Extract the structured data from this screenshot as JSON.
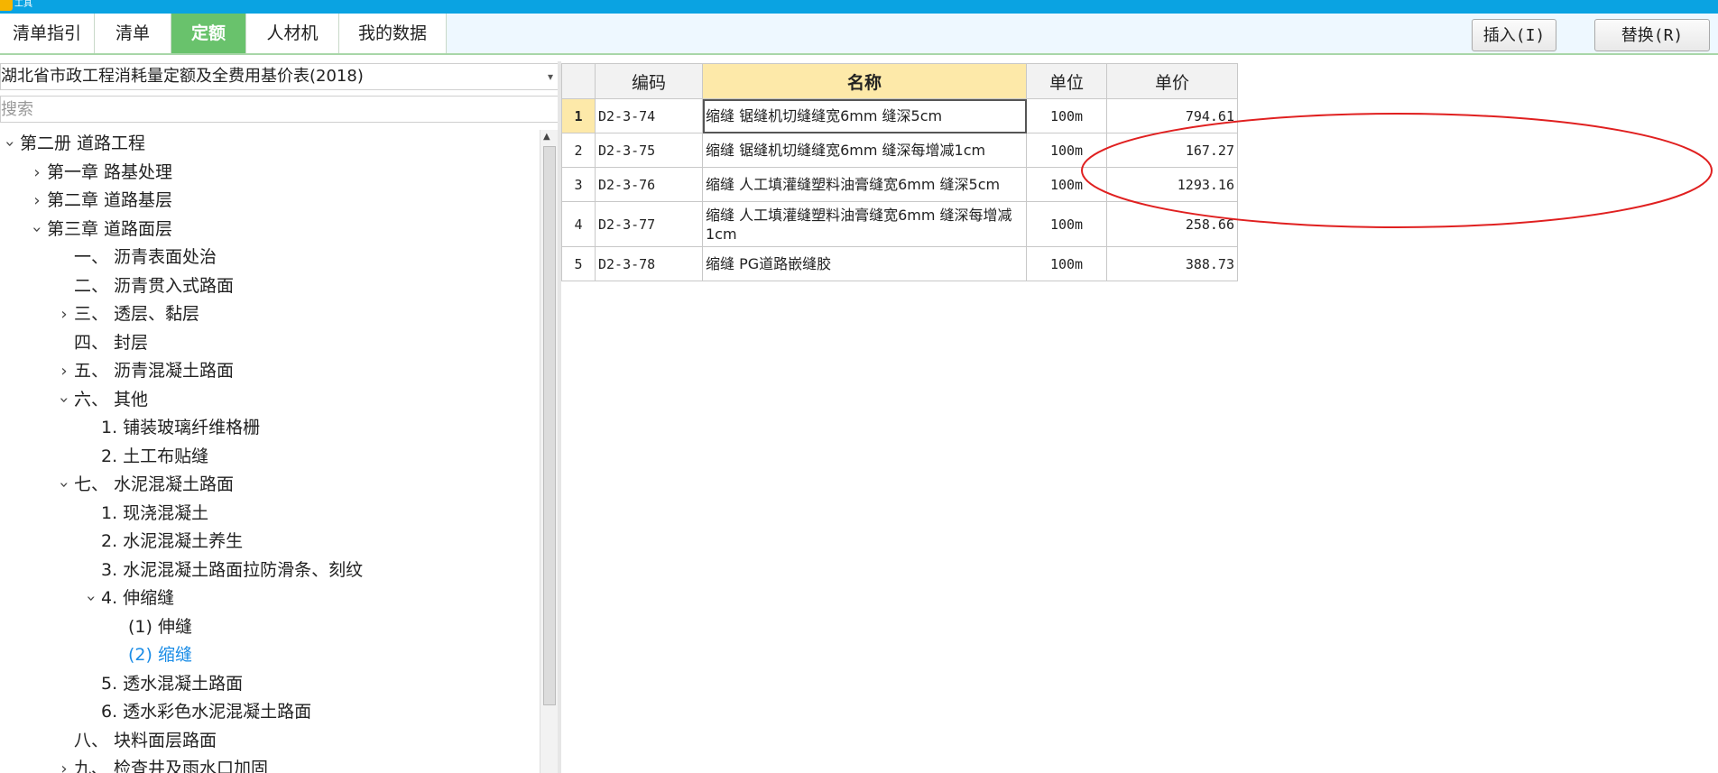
{
  "titlebar": {
    "title": "工具"
  },
  "tabs": [
    {
      "label": "清单指引",
      "active": false
    },
    {
      "label": "清单",
      "active": false
    },
    {
      "label": "定额",
      "active": true
    },
    {
      "label": "人材机",
      "active": false
    },
    {
      "label": "我的数据",
      "active": false
    }
  ],
  "buttons": {
    "insert": "插入(I)",
    "replace": "替换(R)"
  },
  "library": {
    "selected": "湖北省市政工程消耗量定额及全费用基价表(2018)"
  },
  "search": {
    "placeholder": "搜索"
  },
  "tree": [
    {
      "label": "第二册 道路工程",
      "level": 0,
      "state": "expanded",
      "selected": false
    },
    {
      "label": "第一章 路基处理",
      "level": 1,
      "state": "collapsed",
      "selected": false
    },
    {
      "label": "第二章 道路基层",
      "level": 1,
      "state": "collapsed",
      "selected": false
    },
    {
      "label": "第三章 道路面层",
      "level": 1,
      "state": "expanded",
      "selected": false
    },
    {
      "label": "一、 沥青表面处治",
      "level": 2,
      "state": "leaf",
      "selected": false
    },
    {
      "label": "二、 沥青贯入式路面",
      "level": 2,
      "state": "leaf",
      "selected": false
    },
    {
      "label": "三、 透层、黏层",
      "level": 2,
      "state": "collapsed",
      "selected": false
    },
    {
      "label": "四、 封层",
      "level": 2,
      "state": "leaf",
      "selected": false
    },
    {
      "label": "五、 沥青混凝土路面",
      "level": 2,
      "state": "collapsed",
      "selected": false
    },
    {
      "label": "六、 其他",
      "level": 2,
      "state": "expanded",
      "selected": false
    },
    {
      "label": "1. 铺装玻璃纤维格栅",
      "level": 3,
      "state": "leaf",
      "selected": false
    },
    {
      "label": "2. 土工布贴缝",
      "level": 3,
      "state": "leaf",
      "selected": false
    },
    {
      "label": "七、 水泥混凝土路面",
      "level": 2,
      "state": "expanded",
      "selected": false
    },
    {
      "label": "1. 现浇混凝土",
      "level": 3,
      "state": "leaf",
      "selected": false
    },
    {
      "label": "2. 水泥混凝土养生",
      "level": 3,
      "state": "leaf",
      "selected": false
    },
    {
      "label": "3. 水泥混凝土路面拉防滑条、刻纹",
      "level": 3,
      "state": "leaf",
      "selected": false
    },
    {
      "label": "4. 伸缩缝",
      "level": 3,
      "state": "expanded",
      "selected": false
    },
    {
      "label": "(1) 伸缝",
      "level": 4,
      "state": "leaf",
      "selected": false
    },
    {
      "label": "(2) 缩缝",
      "level": 4,
      "state": "leaf",
      "selected": true
    },
    {
      "label": "5. 透水混凝土路面",
      "level": 3,
      "state": "leaf",
      "selected": false
    },
    {
      "label": "6. 透水彩色水泥混凝土路面",
      "level": 3,
      "state": "leaf",
      "selected": false
    },
    {
      "label": "八、 块料面层路面",
      "level": 2,
      "state": "leaf",
      "selected": false
    },
    {
      "label": "九、 检查井及雨水口加固",
      "level": 2,
      "state": "collapsed",
      "selected": false
    }
  ],
  "table": {
    "columns": {
      "code": "编码",
      "name": "名称",
      "unit": "单位",
      "price": "单价"
    },
    "rows": [
      {
        "num": "1",
        "code": "D2-3-74",
        "name": "缩缝 锯缝机切缝缝宽6mm 缝深5cm",
        "unit": "100m",
        "price": "794.61"
      },
      {
        "num": "2",
        "code": "D2-3-75",
        "name": "缩缝 锯缝机切缝缝宽6mm 缝深每增减1cm",
        "unit": "100m",
        "price": "167.27"
      },
      {
        "num": "3",
        "code": "D2-3-76",
        "name": "缩缝 人工填灌缝塑料油膏缝宽6mm 缝深5cm",
        "unit": "100m",
        "price": "1293.16"
      },
      {
        "num": "4",
        "code": "D2-3-77",
        "name": "缩缝 人工填灌缝塑料油膏缝宽6mm 缝深每增减1cm",
        "unit": "100m",
        "price": "258.66"
      },
      {
        "num": "5",
        "code": "D2-3-78",
        "name": "缩缝 PG道路嵌缝胶",
        "unit": "100m",
        "price": "388.73"
      }
    ]
  },
  "colors": {
    "titlebar": "#0aa3e2",
    "active_tab": "#69c26c",
    "selected_tree_item": "#1a8ce6",
    "active_column": "#fde9a9",
    "annotation": "#e02020"
  }
}
